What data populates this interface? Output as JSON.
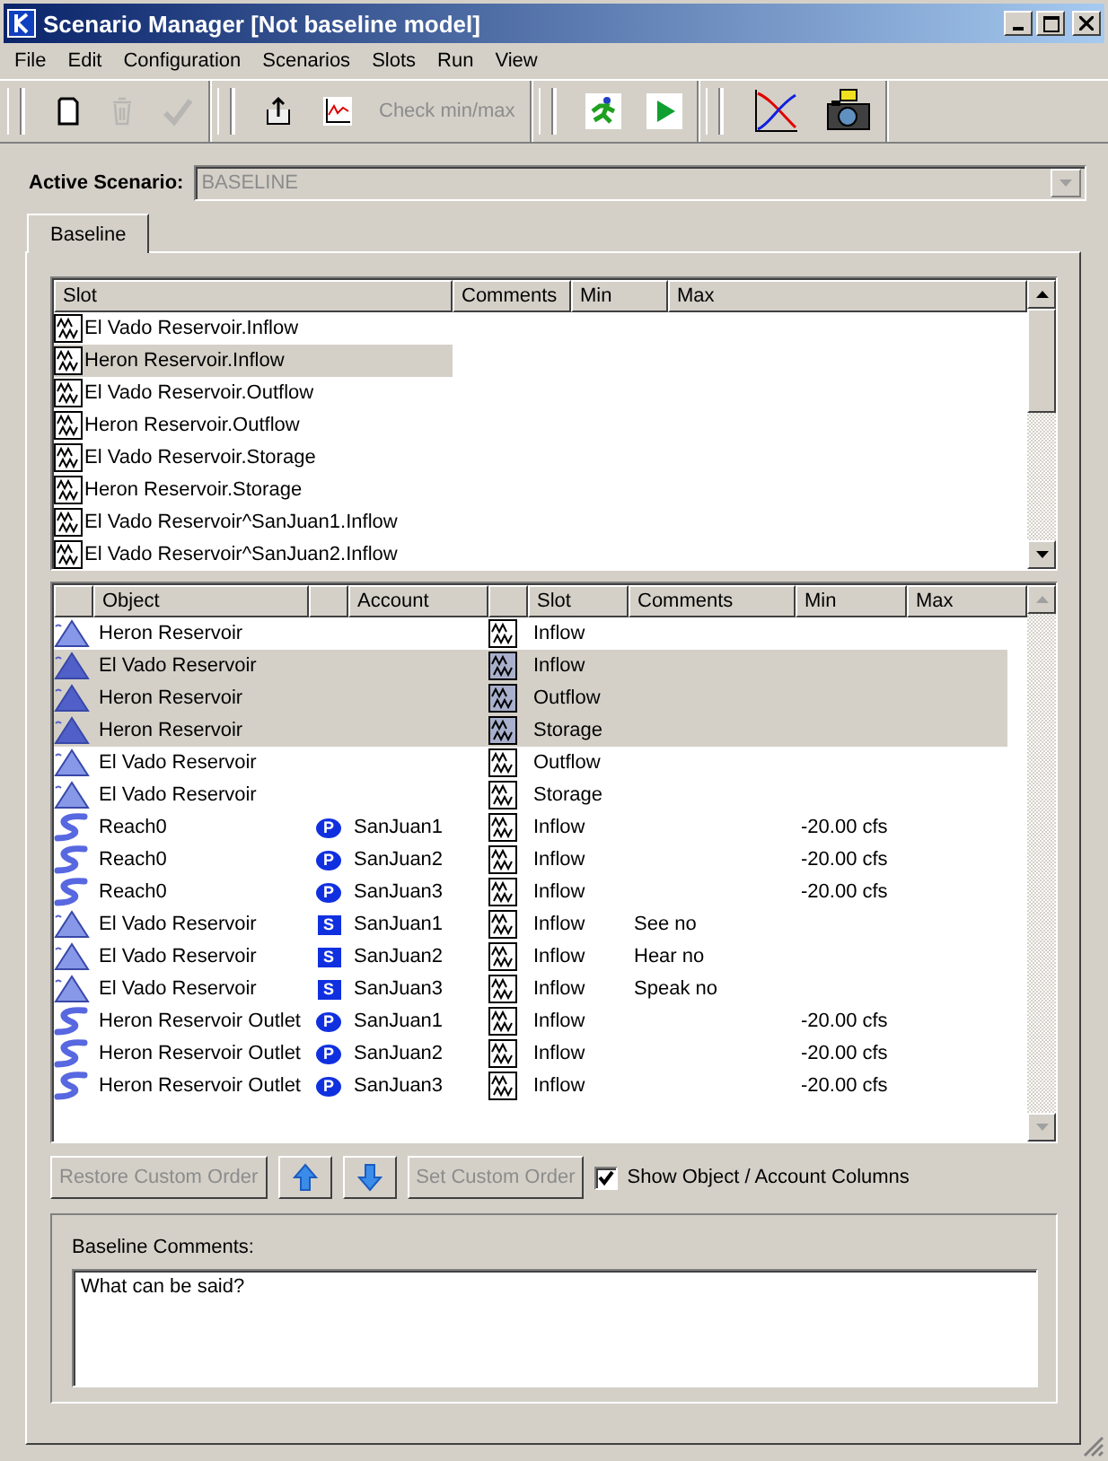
{
  "window": {
    "title": "Scenario Manager [Not baseline model]"
  },
  "menu": [
    "File",
    "Edit",
    "Configuration",
    "Scenarios",
    "Slots",
    "Run",
    "View"
  ],
  "toolbar": [
    [
      {
        "kind": "new",
        "disabled": false
      },
      {
        "kind": "delete",
        "disabled": true
      },
      {
        "kind": "accept",
        "disabled": true
      }
    ],
    [
      {
        "kind": "export",
        "disabled": false
      },
      {
        "kind": "plot",
        "disabled": false
      },
      {
        "kind": "text",
        "label": "Check min/max",
        "disabled": true
      }
    ],
    [
      {
        "kind": "run",
        "disabled": false
      },
      {
        "kind": "play",
        "disabled": false
      }
    ],
    [
      {
        "kind": "chart",
        "disabled": false
      },
      {
        "kind": "camera",
        "disabled": false
      }
    ]
  ],
  "active_scenario": {
    "label": "Active Scenario:",
    "value": "BASELINE",
    "disabled": true
  },
  "tabs": [
    {
      "label": "Baseline",
      "selected": true
    }
  ],
  "slot_table": {
    "columns": [
      "Slot",
      "Comments",
      "Min",
      "Max"
    ],
    "rows": [
      {
        "slot": "El Vado Reservoir.Inflow",
        "selected": false
      },
      {
        "slot": "Heron Reservoir.Inflow",
        "selected": true
      },
      {
        "slot": "El Vado Reservoir.Outflow",
        "selected": false
      },
      {
        "slot": "Heron Reservoir.Outflow",
        "selected": false
      },
      {
        "slot": "El Vado Reservoir.Storage",
        "selected": false
      },
      {
        "slot": "Heron Reservoir.Storage",
        "selected": false
      },
      {
        "slot": "El Vado Reservoir^SanJuan1.Inflow",
        "selected": false
      },
      {
        "slot": "El Vado Reservoir^SanJuan2.Inflow",
        "selected": false
      }
    ]
  },
  "object_table": {
    "columns": [
      "Object",
      "Account",
      "Slot",
      "Comments",
      "Min",
      "Max"
    ],
    "rows": [
      {
        "kind": "reservoir",
        "object": "Heron Reservoir",
        "slot": "Inflow",
        "selected": false
      },
      {
        "kind": "reservoir",
        "object": "El Vado Reservoir",
        "slot": "Inflow",
        "selected": true
      },
      {
        "kind": "reservoir",
        "object": "Heron Reservoir",
        "slot": "Outflow",
        "selected": true
      },
      {
        "kind": "reservoir",
        "object": "Heron Reservoir",
        "slot": "Storage",
        "selected": true
      },
      {
        "kind": "reservoir",
        "object": "El Vado Reservoir",
        "slot": "Outflow",
        "selected": false
      },
      {
        "kind": "reservoir",
        "object": "El Vado Reservoir",
        "slot": "Storage",
        "selected": false
      },
      {
        "kind": "reach",
        "object": "Reach0",
        "badge": "P",
        "account": "SanJuan1",
        "slot": "Inflow",
        "min": "-20.00 cfs",
        "selected": false
      },
      {
        "kind": "reach",
        "object": "Reach0",
        "badge": "P",
        "account": "SanJuan2",
        "slot": "Inflow",
        "min": "-20.00 cfs",
        "selected": false
      },
      {
        "kind": "reach",
        "object": "Reach0",
        "badge": "P",
        "account": "SanJuan3",
        "slot": "Inflow",
        "min": "-20.00 cfs",
        "selected": false
      },
      {
        "kind": "reservoir",
        "object": "El Vado Reservoir",
        "badge": "S",
        "account": "SanJuan1",
        "slot": "Inflow",
        "comments": "See no",
        "selected": false
      },
      {
        "kind": "reservoir",
        "object": "El Vado Reservoir",
        "badge": "S",
        "account": "SanJuan2",
        "slot": "Inflow",
        "comments": "Hear no",
        "selected": false
      },
      {
        "kind": "reservoir",
        "object": "El Vado Reservoir",
        "badge": "S",
        "account": "SanJuan3",
        "slot": "Inflow",
        "comments": "Speak no",
        "selected": false
      },
      {
        "kind": "reach",
        "object": "Heron Reservoir Outlet",
        "badge": "P",
        "account": "SanJuan1",
        "slot": "Inflow",
        "min": "-20.00 cfs",
        "selected": false
      },
      {
        "kind": "reach",
        "object": "Heron Reservoir Outlet",
        "badge": "P",
        "account": "SanJuan2",
        "slot": "Inflow",
        "min": "-20.00 cfs",
        "selected": false
      },
      {
        "kind": "reach",
        "object": "Heron Reservoir Outlet",
        "badge": "P",
        "account": "SanJuan3",
        "slot": "Inflow",
        "min": "-20.00 cfs",
        "selected": false
      }
    ]
  },
  "buttons": [
    {
      "kind": "text",
      "label": "Restore Custom Order",
      "disabled": true
    },
    {
      "kind": "up",
      "disabled": false
    },
    {
      "kind": "down",
      "disabled": false
    },
    {
      "kind": "text",
      "label": "Set Custom Order",
      "disabled": true
    }
  ],
  "show_columns": {
    "label": "Show Object / Account Columns",
    "checked": true
  },
  "comments": {
    "label": "Baseline Comments:",
    "value": "What can be said?"
  }
}
